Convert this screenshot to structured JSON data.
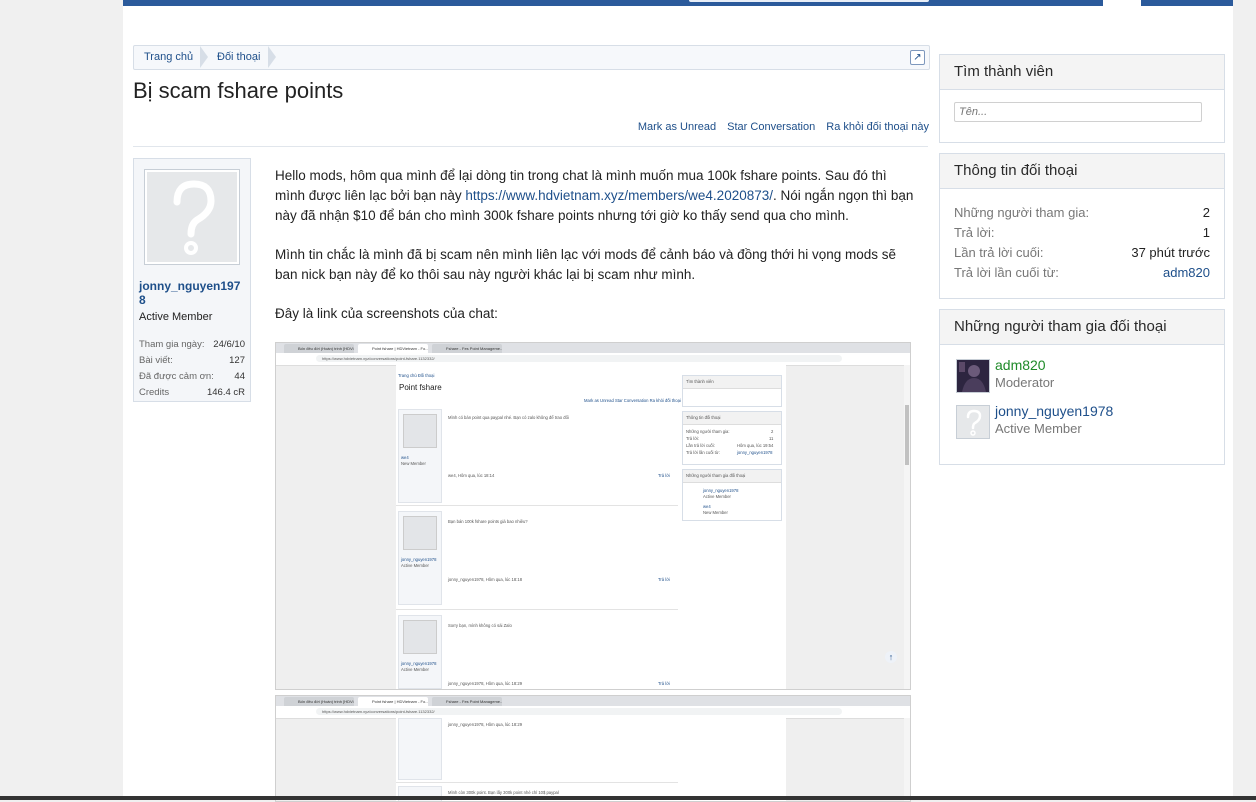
{
  "breadcrumb": {
    "home": "Trang chủ",
    "conversations": "Đối thoại",
    "jump_icon": "external-link-icon"
  },
  "thread": {
    "title": "Bị scam fshare points",
    "actions": {
      "mark_unread": "Mark as Unread",
      "star": "Star Conversation",
      "leave": "Ra khỏi đối thoại này"
    }
  },
  "message": {
    "user": {
      "name": "jonny_nguyen1978",
      "title": "Active Member",
      "stats": [
        {
          "label": "Tham gia ngày:",
          "value": "24/6/10"
        },
        {
          "label": "Bài viết:",
          "value": "127"
        },
        {
          "label": "Đã được cảm ơn:",
          "value": "44"
        },
        {
          "label": "Credits",
          "value": "146.4 cR"
        }
      ]
    },
    "p1_before": "Hello mods, hôm qua mình để lại dòng tin trong chat là mình muốn mua 100k fshare points. Sau đó thì mình được liên lạc bởi bạn này ",
    "p1_link": "https://www.hdvietnam.xyz/members/we4.2020873/",
    "p1_after": ". Nói ngắn ngọn thì bạn này đã nhận $10 để bán cho mình 300k fshare points nhưng tới giờ ko thấy send qua cho mình.",
    "p2": "Mình tin chắc là mình đã bị scam nên mình liên lạc với mods để cảnh báo và đồng thới hi vọng mods sẽ ban nick bạn này để ko thôi sau này người khác lại bị scam như mình.",
    "p3": "Đây là link của screenshots của chat:"
  },
  "screenshot1": {
    "tabs": [
      "Bốn đêu đời (Hoàn) trinh [HDVi...",
      "Point fshare | HDVietnam - Fo...",
      "Fshare - Fes Point Manageme..."
    ],
    "url": "https://www.hdvietnam.xyz/conversations/point-fshare.1132332/",
    "crumbs": "Trang chủ    Đối thoại",
    "page_title": "Point fshare",
    "actions": "Mark as Unread   Star Conversation   Ra khỏi đối thoại này",
    "msg1": "Mình có bán point qua paypal nhé. Bạn có zalo không để trao đổi",
    "msg1_user": "we4",
    "msg1_user_title": "New Member",
    "msg1_meta": "we4, Hôm qua, lúc 18:14",
    "msg2": "Bạn bán 100k fshare points giá bao nhiêu?",
    "msg2_user": "jonny_nguyen1978",
    "msg2_user_title": "Active Member",
    "msg2_meta": "jonny_nguyen1978, Hôm qua, lúc 18:18",
    "msg3": "Sorry bạn, mình không có sài Zalo",
    "msg3_meta": "jonny_nguyen1978, Hôm qua, lúc 18:29",
    "report": "Báo cáo",
    "reply": "Trả lời",
    "side_find": "Tìm thành viên",
    "side_info": "Thông tin đối thoại",
    "side_info_rows": [
      {
        "label": "Những người tham gia:",
        "value": "2"
      },
      {
        "label": "Trả lời:",
        "value": "11"
      },
      {
        "label": "Lần trả lời cuối:",
        "value": "Hôm qua, lúc 19:54"
      },
      {
        "label": "Trả lời lần cuối từ:",
        "value": "jonny_nguyen1978"
      }
    ],
    "side_part": "Những người tham gia đối thoại",
    "side_part_users": [
      {
        "name": "jonny_nguyen1978",
        "title": "Active Member"
      },
      {
        "name": "we4",
        "title": "New Member"
      }
    ]
  },
  "screenshot2": {
    "url": "https://www.hdvietnam.xyz/conversations/point-fshare.1132332/",
    "msg_meta": "jonny_nguyen1978, Hôm qua, lúc 18:29",
    "msg": "Mình còn 300k point. Bạn lấy 300k point nhé chỉ 10$ paypal"
  },
  "sidebar": {
    "find_member": {
      "title": "Tìm thành viên",
      "placeholder": "Tên..."
    },
    "conversation_info": {
      "title": "Thông tin đối thoại",
      "rows": [
        {
          "label": "Những người tham gia:",
          "value": "2"
        },
        {
          "label": "Trả lời:",
          "value": "1"
        },
        {
          "label": "Lần trả lời cuối:",
          "value": "37 phút trước"
        },
        {
          "label": "Trả lời lần cuối từ:",
          "value": "adm820"
        }
      ]
    },
    "participants": {
      "title": "Những người tham gia đối thoại",
      "users": [
        {
          "name": "adm820",
          "title": "Moderator",
          "color": "#1e8a28"
        },
        {
          "name": "jonny_nguyen1978",
          "title": "Active Member",
          "color": "#1e4f8a"
        }
      ]
    }
  }
}
